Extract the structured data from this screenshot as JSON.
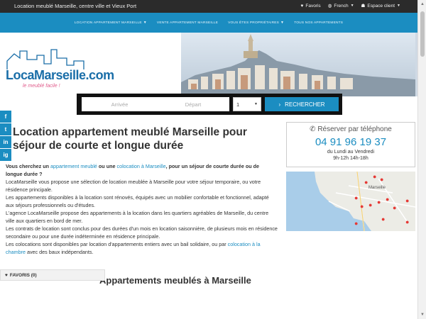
{
  "topbar": {
    "site_title": "Location meublé Marseille, centre ville et Vieux Port",
    "favoris": "Favoris",
    "language": "French",
    "client": "Espace client"
  },
  "nav": {
    "items": [
      "LOCATION APPARTEMENT MARSEILLE",
      "VENTE APPARTEMENT MARSEILLE",
      "VOUS ÊTES PROPRIÉTAIRES",
      "TOUS NOS APPARTEMENTS"
    ]
  },
  "logo": {
    "text": "LocaMarseille.com",
    "tagline": "le meublé facile !"
  },
  "search": {
    "arrival_placeholder": "Arrivée",
    "departure_placeholder": "Départ",
    "guests_value": "1",
    "button_label": "RECHERCHER"
  },
  "social": {
    "icons": [
      "f",
      "t",
      "in",
      "ig"
    ]
  },
  "main": {
    "title": "Location appartement meublé Marseille pour séjour de courte et longue durée",
    "lead_1": "Vous cherchez un ",
    "lead_link_1": "appartement meublé",
    "lead_2": " ou une ",
    "lead_link_2": "colocation à Marseille",
    "lead_3": ", pour un séjour de courte durée ou de longue durée ?",
    "p1": "LocaMarseille vous propose une sélection de location meublée à Marseille pour votre séjour temporaire, ou votre résidence principale.",
    "p2": "Les appartements disponibles à la location sont rénovés, équipés avec un mobilier confortable et fonctionnel, adapté aux séjours professionnels ou d'études.",
    "p3": "L'agence LocaMarseille propose des appartements à la location dans les quartiers agréables de Marseille, du centre ville aux quartiers en bord de mer.",
    "p4": "Les contrats de location sont conclus pour des durées d'un mois en location saisonnière, de plusieurs mois en résidence secondaire ou pour une durée indéterminée en résidence principale.",
    "p5_1": "Les colocations sont disponibles par location d'appartements entiers avec un bail solidaire, ou par ",
    "p5_link": "colocation à la chambre",
    "p5_2": " avec des baux indépendants.",
    "sub_title": "Appartements meublés à Marseille"
  },
  "phone_box": {
    "title": "Réserver par téléphone",
    "number": "04 91 96 19 37",
    "days": "du Lundi au Vendredi",
    "hours": "9h-12h  14h-18h"
  },
  "map": {
    "label": "Marseille"
  },
  "favoris_bar": {
    "label": "FAVORIS (0)"
  },
  "colors": {
    "accent": "#1b8dc1",
    "topbar": "#2b2b2b",
    "search_bg": "#111111"
  },
  "icons": [
    "heart-icon",
    "globe-icon",
    "user-icon",
    "chevron-right-icon",
    "phone-icon",
    "map-pin-icon"
  ]
}
